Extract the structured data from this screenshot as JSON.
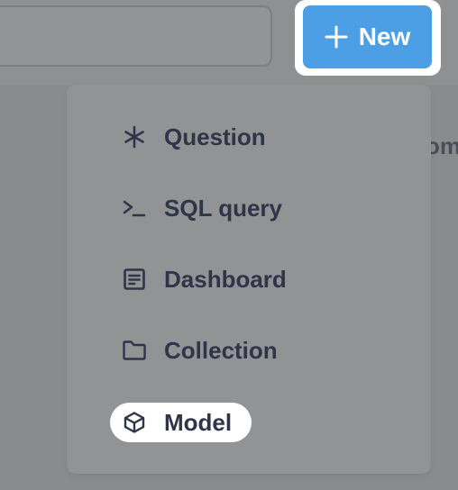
{
  "header": {
    "new_button_label": "New",
    "clipped_text": "om"
  },
  "menu": {
    "items": [
      {
        "label": "Question",
        "icon": "sparkle-icon"
      },
      {
        "label": "SQL query",
        "icon": "terminal-icon"
      },
      {
        "label": "Dashboard",
        "icon": "dashboard-icon"
      },
      {
        "label": "Collection",
        "icon": "folder-icon"
      },
      {
        "label": "Model",
        "icon": "cube-icon"
      }
    ]
  },
  "colors": {
    "accent": "#4c9fe4",
    "overlay": "#8a8b8d",
    "text": "#2f3448"
  }
}
